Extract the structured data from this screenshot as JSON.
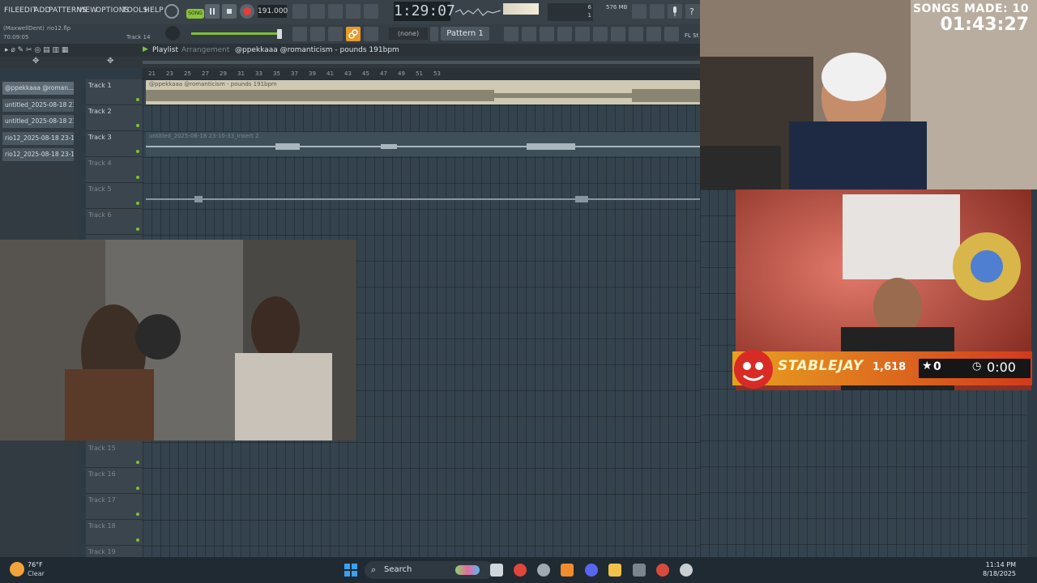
{
  "menu": {
    "items": [
      "FILE",
      "EDIT",
      "ADD",
      "PATTERNS",
      "VIEW",
      "OPTIONS",
      "TOOLS",
      "HELP"
    ],
    "song_label": "SONG",
    "tempo": "191.000",
    "time": "1:29:07",
    "memory": "576 MB",
    "cpu_top": "6",
    "cpu_bottom": "1"
  },
  "info_panel": {
    "user": "(MaxwellDent)",
    "file": "rio12.flp",
    "elapsed": "70:09:05",
    "track": "Track 14"
  },
  "toolbar2": {
    "none_label": "(none)",
    "pattern": "Pattern 1",
    "browser_right": "FL St"
  },
  "playlist": {
    "title": "Playlist",
    "mode": "Arrangement",
    "breadcrumb": "@ppekkaaa @romanticism - pounds 191bpm",
    "ruler": [
      "21",
      "23",
      "25",
      "27",
      "29",
      "31",
      "33",
      "35",
      "37",
      "39",
      "41",
      "43",
      "45",
      "47",
      "49",
      "51",
      "53"
    ],
    "picker": [
      "@ppekkaaa @roman...",
      "untitled_2025-08-18 23-...",
      "untitled_2025-08-18 23-...",
      "rio12_2025-08-18 23-12...",
      "rio12_2025-08-18 23-13..."
    ],
    "tracks": [
      "Track 1",
      "Track 2",
      "Track 3",
      "Track 4",
      "Track 5",
      "Track 6"
    ],
    "tracks_lower": [
      "Track 15",
      "Track 16",
      "Track 17",
      "Track 18",
      "Track 19"
    ],
    "clip1_label": "@ppekkaaa @romanticism - pounds 191bpm",
    "clip3_label": "untitled_2025-08-18 23-10-33_Insert 2"
  },
  "overlay": {
    "songs_label": "SONGS MADE: 10",
    "songs_timer": "01:43:27",
    "streamer": "STABLEJAY",
    "followers": "1,618",
    "stars": "0",
    "timer": "0:00"
  },
  "taskbar": {
    "temp": "76°F",
    "weather": "Clear",
    "search": "Search",
    "time": "11:14 PM",
    "date": "8/18/2025"
  },
  "colors": {
    "accent_orange": "#e89a2a",
    "record_red": "#e0413a",
    "song_green": "#8bc23f"
  }
}
